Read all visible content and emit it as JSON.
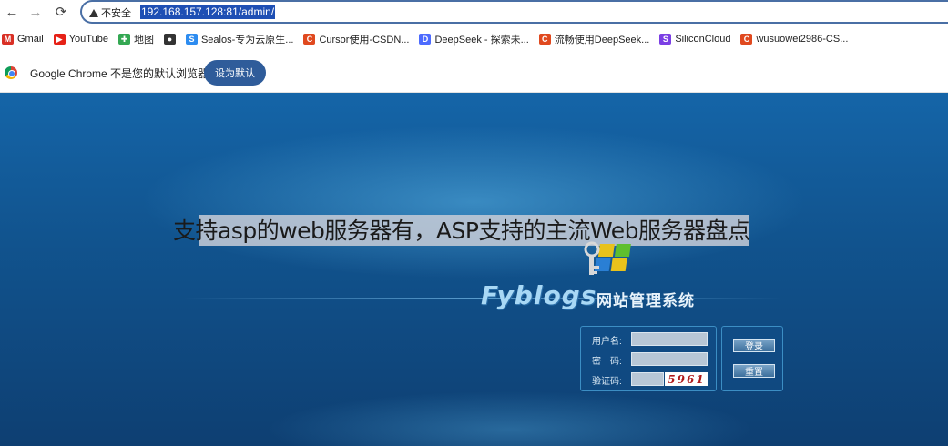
{
  "browser": {
    "nav": {
      "back": "←",
      "forward": "→",
      "reload": "⟳"
    },
    "address": {
      "security_label": "不安全",
      "url": "192.168.157.128:81/admin/"
    },
    "bookmarks": [
      {
        "label": "Gmail",
        "icon": "gmail-icon",
        "glyph": "M",
        "color": "#d93025"
      },
      {
        "label": "YouTube",
        "icon": "youtube-icon",
        "glyph": "▶",
        "color": "#e62117"
      },
      {
        "label": "地图",
        "icon": "maps-icon",
        "glyph": "✚",
        "color": "#34a853"
      },
      {
        "label": "",
        "icon": "globe-icon",
        "glyph": "●",
        "color": "#333333"
      },
      {
        "label": "Sealos-专为云原生...",
        "icon": "sealos-icon",
        "glyph": "S",
        "color": "#2d8cf0"
      },
      {
        "label": "Cursor使用-CSDN...",
        "icon": "csdn-icon",
        "glyph": "C",
        "color": "#e0491f"
      },
      {
        "label": "DeepSeek - 探索未...",
        "icon": "deepseek-icon",
        "glyph": "D",
        "color": "#4d6bfe"
      },
      {
        "label": "流畅使用DeepSeek...",
        "icon": "csdn-icon",
        "glyph": "C",
        "color": "#e0491f"
      },
      {
        "label": "SiliconCloud",
        "icon": "siliconcloud-icon",
        "glyph": "S",
        "color": "#7b3fe4"
      },
      {
        "label": "wusuowei2986-CS...",
        "icon": "csdn-icon",
        "glyph": "C",
        "color": "#e0491f"
      }
    ],
    "infobar": {
      "message": "Google Chrome 不是您的默认浏览器",
      "button": "设为默认"
    }
  },
  "page": {
    "overlay_caption": "支持asp的web服务器有，ASP支持的主流Web服务器盘点",
    "brand": "Fyblogs",
    "brand_cn": "网站管理系统",
    "login": {
      "username_label": "用户名:",
      "password_label": "密　码:",
      "captcha_label": "验证码:",
      "captcha_value": "5961",
      "username_value": "",
      "password_value": "",
      "captcha_input": "",
      "login_button": "登录",
      "reset_button": "重置"
    }
  }
}
